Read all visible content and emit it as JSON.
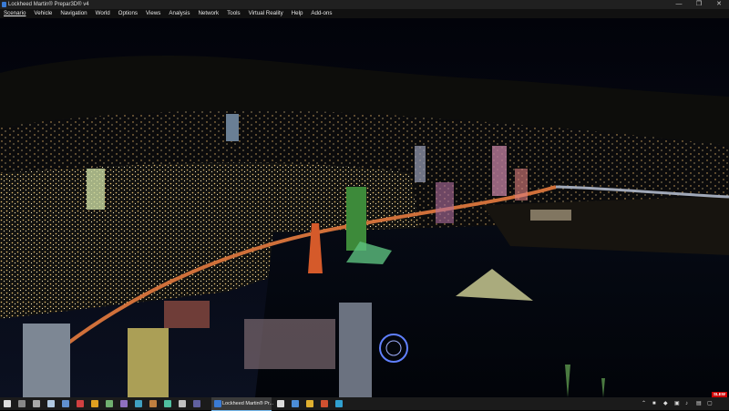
{
  "window": {
    "title": "Lockheed Martin® Prepar3D® v4",
    "minimize_glyph": "—",
    "maximize_glyph": "❐",
    "close_glyph": "✕"
  },
  "menu": {
    "items": [
      "Scenario",
      "Vehicle",
      "Navigation",
      "World",
      "Options",
      "Views",
      "Analysis",
      "Network",
      "Tools",
      "Virtual Reality",
      "Help",
      "Add-ons"
    ]
  },
  "scene": {
    "description_icon": "night-city-harbor-view"
  },
  "overlay": {
    "slew_label": "SLEW"
  },
  "taskbar": {
    "active_app_label": "Lockheed Martin® Pr...",
    "pinned_icons": [
      "windows-start-icon",
      "search-icon",
      "task-view-icon",
      "app-icon",
      "app-icon",
      "app-icon",
      "app-icon",
      "app-icon",
      "app-icon",
      "app-icon",
      "app-icon",
      "app-icon",
      "app-icon",
      "app-icon",
      "app-icon",
      "app-icon",
      "app-icon",
      "app-icon",
      "app-icon",
      "app-icon",
      "app-icon",
      "app-icon",
      "app-icon"
    ],
    "right_icons": [
      "app-icon",
      "app-icon",
      "app-icon",
      "app-icon",
      "app-icon",
      "app-icon",
      "app-icon"
    ]
  },
  "colors": {
    "titlebar": "#202020",
    "menubar": "#111111",
    "taskbar": "#1b1b1b",
    "accent": "#76b9ed",
    "slew": "#cc0000"
  }
}
